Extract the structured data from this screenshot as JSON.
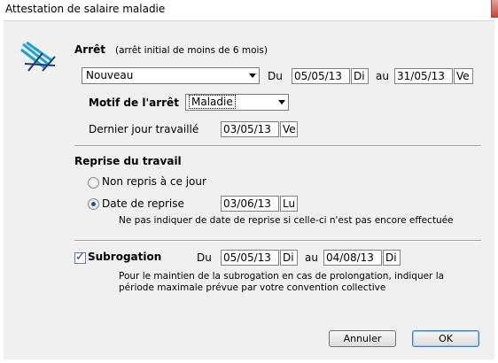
{
  "window": {
    "title": "Attestation de salaire maladie"
  },
  "arret": {
    "title": "Arrêt",
    "subtitle": "(arrêt initial de moins de 6 mois)",
    "type_value": "Nouveau",
    "du_label": "Du",
    "start_date": "05/05/13",
    "start_day": "Di",
    "au_label": "au",
    "end_date": "31/05/13",
    "end_day": "Ve",
    "motif_label": "Motif de l'arrêt",
    "motif_value": "Maladie",
    "dernier_label": "Dernier jour travaillé",
    "dernier_date": "03/05/13",
    "dernier_day": "Ve"
  },
  "reprise": {
    "title": "Reprise du travail",
    "option_non_repris": "Non repris à ce jour",
    "option_date": "Date de reprise",
    "selected": "date",
    "date": "03/06/13",
    "day": "Lu",
    "note": "Ne pas indiquer de date de reprise si celle-ci n'est pas encore effectuée"
  },
  "subrogation": {
    "label": "Subrogation",
    "checked": true,
    "du_label": "Du",
    "start_date": "05/05/13",
    "start_day": "Di",
    "au_label": "au",
    "end_date": "04/08/13",
    "end_day": "Di",
    "note_line1": "Pour le maintien de la subrogation en cas de prolongation, indiquer la",
    "note_line2": "période maximale prévue par votre convention collective"
  },
  "buttons": {
    "cancel": "Annuler",
    "ok": "OK"
  },
  "colors": {
    "client_bg": "#f0f0f0",
    "logo_blue": "#1aa0d8",
    "logo_dark": "#1b3a6b"
  }
}
